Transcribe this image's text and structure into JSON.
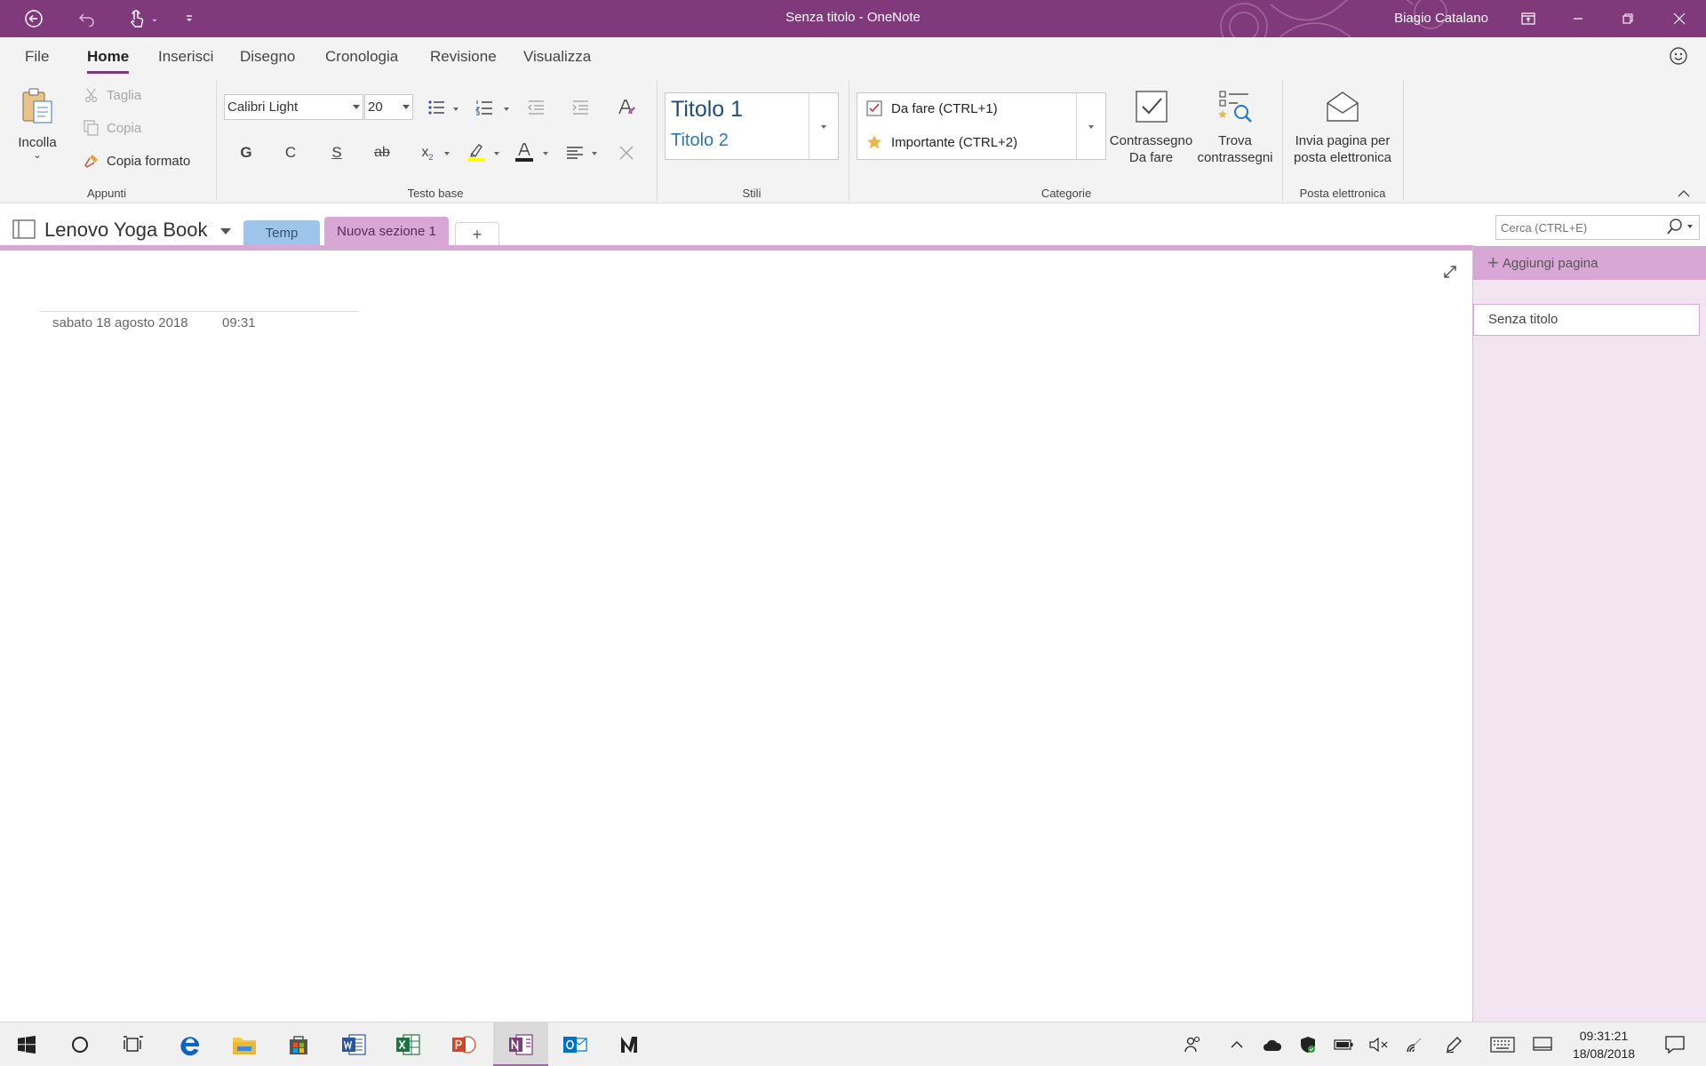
{
  "window": {
    "title": "Senza titolo  -  OneNote",
    "user": "Biagio Catalano"
  },
  "ribbon_tabs": [
    "File",
    "Home",
    "Inserisci",
    "Disegno",
    "Cronologia",
    "Revisione",
    "Visualizza"
  ],
  "ribbon_active_tab": "Home",
  "clipboard": {
    "paste": "Incolla",
    "cut": "Taglia",
    "copy": "Copia",
    "format_painter": "Copia formato",
    "label": "Appunti"
  },
  "basic_text": {
    "font": "Calibri Light",
    "size": "20",
    "bold": "G",
    "italic": "C",
    "underline": "S",
    "strike": "ab",
    "subscript": "x",
    "label": "Testo base"
  },
  "styles": {
    "heading1": "Titolo 1",
    "heading2": "Titolo 2",
    "label": "Stili"
  },
  "tags": {
    "todo": "Da fare (CTRL+1)",
    "important": "Importante (CTRL+2)",
    "todo_tag_line1": "Contrassegno",
    "todo_tag_line2": "Da fare",
    "find_tags_line1": "Trova",
    "find_tags_line2": "contrassegni",
    "label": "Categorie"
  },
  "email": {
    "send_line1": "Invia pagina per",
    "send_line2": "posta elettronica",
    "label": "Posta elettronica"
  },
  "notebook": {
    "name": "Lenovo Yoga Book",
    "sections": [
      "Temp",
      "Nuova sezione 1"
    ],
    "add_section": "+"
  },
  "search": {
    "placeholder": "Cerca (CTRL+E)"
  },
  "pages": {
    "add_page": "Aggiungi pagina",
    "items": [
      "Senza titolo"
    ]
  },
  "page": {
    "date": "sabato 18 agosto 2018",
    "time": "09:31"
  },
  "taskbar": {
    "time": "09:31:21",
    "date": "18/08/2018"
  },
  "colors": {
    "brand": "#80397b",
    "section_active": "#d9a7d5",
    "section_temp": "#9fc4ea",
    "page_pane": "#f3e4f2"
  }
}
